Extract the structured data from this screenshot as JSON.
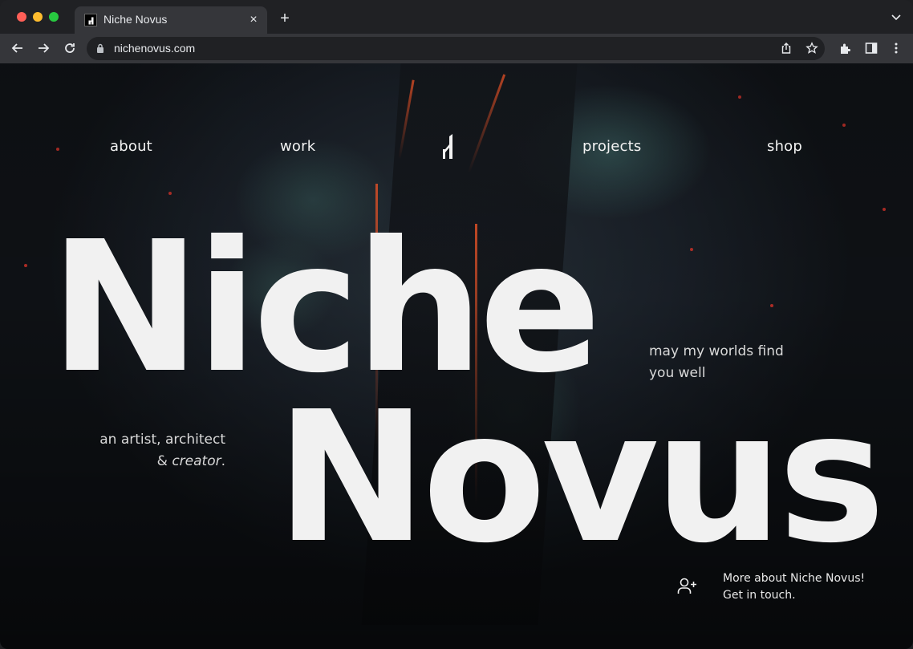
{
  "browser": {
    "tab_title": "Niche Novus",
    "tab_close": "×",
    "new_tab": "+",
    "url": "nichenovus.com"
  },
  "nav": {
    "about": "about",
    "work": "work",
    "projects": "projects",
    "shop": "shop"
  },
  "hero": {
    "word1": "Niche",
    "word2": "Novus",
    "tagline_line1": "may my worlds find",
    "tagline_line2": "you well",
    "role_line1": "an artist, architect",
    "role_prefix": "& ",
    "role_emph": "creator",
    "role_suffix": "."
  },
  "contact": {
    "line1": "More about Niche Novus!",
    "line2": "Get in touch."
  },
  "colors": {
    "text": "#f1f1f1",
    "chrome_bg": "#202124",
    "toolbar_bg": "#35363a",
    "accent_glow": "#ff5a2a"
  },
  "icons": [
    "back-arrow-icon",
    "forward-arrow-icon",
    "reload-icon",
    "lock-icon",
    "share-icon",
    "star-icon",
    "extensions-icon",
    "side-panel-icon",
    "more-icon",
    "logo-icon",
    "add-user-icon"
  ]
}
